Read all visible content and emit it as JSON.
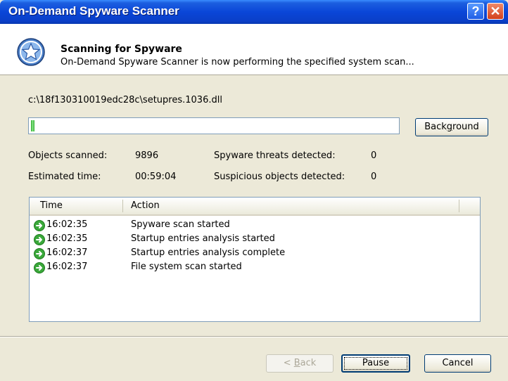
{
  "window": {
    "title": "On-Demand Spyware Scanner",
    "help_button": "?",
    "close_button": "✕",
    "colors": {
      "titlebar": "#0a46d8",
      "progress_fill": "#2ca82c"
    }
  },
  "header": {
    "icon": "shield-star-icon",
    "title": "Scanning for Spyware",
    "subtitle": "On-Demand Spyware Scanner is now performing the specified system scan..."
  },
  "scan": {
    "current_file": "c:\\18f130310019edc28c\\setupres.1036.dll",
    "progress_percent": 1,
    "background_button": "Background",
    "stats": {
      "objects_scanned_label": "Objects scanned:",
      "objects_scanned_value": "9896",
      "estimated_time_label": "Estimated time:",
      "estimated_time_value": "00:59:04",
      "threats_label": "Spyware threats detected:",
      "threats_value": "0",
      "suspicious_label": "Suspicious objects detected:",
      "suspicious_value": "0"
    }
  },
  "log": {
    "columns": [
      "Time",
      "Action"
    ],
    "rows": [
      {
        "icon": "green-arrow-icon",
        "time": "16:02:35",
        "action": "Spyware scan started"
      },
      {
        "icon": "green-arrow-icon",
        "time": "16:02:35",
        "action": "Startup entries analysis started"
      },
      {
        "icon": "green-arrow-icon",
        "time": "16:02:37",
        "action": "Startup entries analysis complete"
      },
      {
        "icon": "green-arrow-icon",
        "time": "16:02:37",
        "action": "File system scan started"
      }
    ]
  },
  "footer": {
    "back_button": "< Back",
    "pause_button": "Pause",
    "cancel_button": "Cancel"
  }
}
